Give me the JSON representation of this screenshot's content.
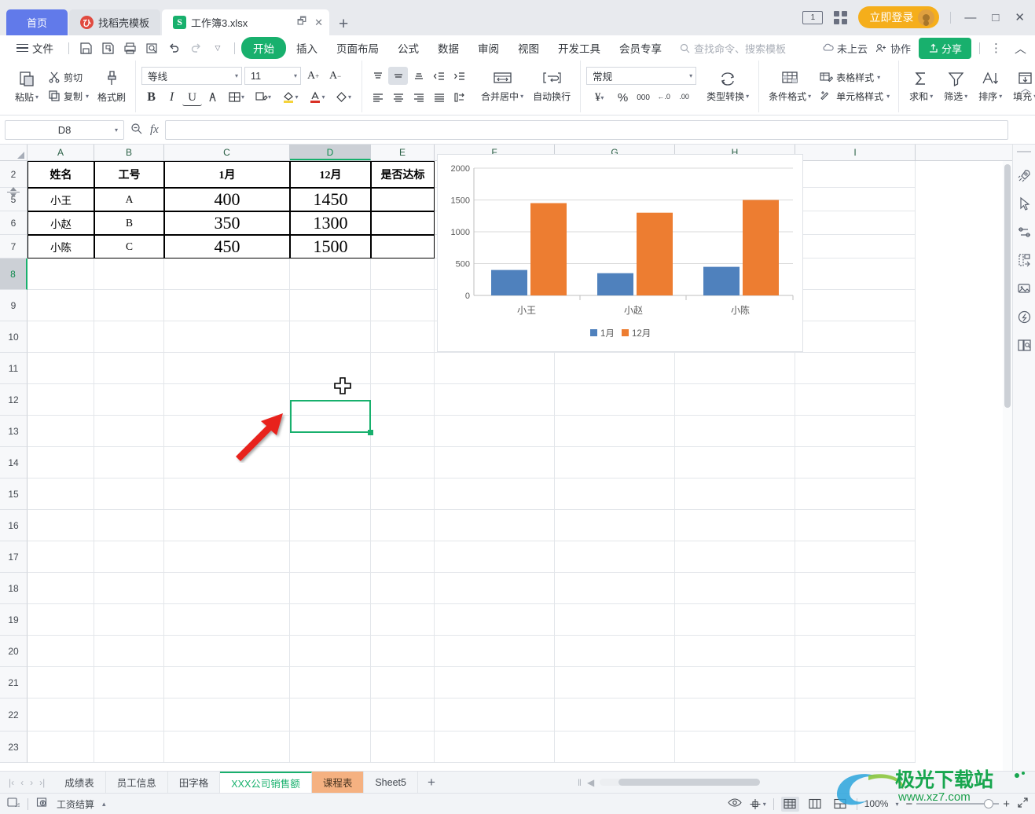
{
  "window": {
    "doc_tabs": [
      {
        "label": "首页",
        "icon": "home-icon"
      },
      {
        "label": "找稻壳模板",
        "icon": "docer-icon"
      },
      {
        "label": "工作簿3.xlsx",
        "icon": "spreadsheet-icon"
      }
    ],
    "new_tab": "+",
    "login_button": "立即登录",
    "minimize": "—",
    "maximize": "□",
    "close": "✕",
    "page_count_icon": "1",
    "layout_icon": "grid-icon"
  },
  "menu": {
    "file_label": "文件",
    "quick_access": [
      "save-icon",
      "save-as-icon",
      "print-icon",
      "print-preview-icon",
      "undo-icon",
      "redo-icon",
      "customize-icon"
    ],
    "tabs": [
      "开始",
      "插入",
      "页面布局",
      "公式",
      "数据",
      "审阅",
      "视图",
      "开发工具",
      "会员专享"
    ],
    "active_tab": "开始",
    "search_placeholder": "查找命令、搜索模板",
    "cloud_status": "未上云",
    "collaborate": "协作",
    "share": "分享",
    "more": "⋮",
    "collapse": "︿"
  },
  "ribbon": {
    "clipboard": {
      "paste": "粘贴",
      "cut": "剪切",
      "copy": "复制",
      "format_painter": "格式刷"
    },
    "font": {
      "family": "等线",
      "size": "11",
      "grow": "A+",
      "shrink": "A-",
      "bold": "B",
      "italic": "I",
      "underline": "U",
      "strike": "A",
      "borders": "borders-icon",
      "pinyin": "pinyin-icon",
      "fill": "fill-color-icon",
      "fontcolor": "font-color-icon",
      "clear": "clear-format-icon"
    },
    "alignment": {
      "top": "align-top-icon",
      "middle": "align-middle-icon",
      "bottom": "align-bottom-icon",
      "dec_indent": "decrease-indent-icon",
      "inc_indent": "increase-indent-icon",
      "left": "align-left-icon",
      "center": "align-center-icon",
      "right": "align-right-icon",
      "justify": "justify-icon",
      "orientation": "orientation-icon",
      "merge": "合并居中",
      "wrap": "自动换行"
    },
    "number": {
      "format": "常规",
      "currency": "¥",
      "percent": "%",
      "comma": "000",
      "dec_decimal": "←.0",
      "inc_decimal": ".00",
      "convert": "类型转换"
    },
    "styles": {
      "conditional": "条件格式",
      "table_style": "表格样式",
      "cell_style": "单元格样式"
    },
    "editing": {
      "sum": "求和",
      "filter": "筛选",
      "sort": "排序",
      "fill": "填充"
    }
  },
  "formula_bar": {
    "name_box": "D8",
    "fx_label": "fx",
    "zoom_icon": "zoom-out-icon",
    "value": ""
  },
  "sheet": {
    "columns": [
      "A",
      "B",
      "C",
      "D",
      "E",
      "F",
      "G",
      "H",
      "I"
    ],
    "selected_column": "D",
    "selected_row": "8",
    "visible_rows": [
      "2",
      "5",
      "6",
      "7",
      "8",
      "9",
      "10",
      "11",
      "12",
      "13",
      "14",
      "15",
      "16",
      "17",
      "18",
      "19",
      "20",
      "21",
      "22",
      "23"
    ],
    "table": {
      "headers": [
        "姓名",
        "工号",
        "1月",
        "12月",
        "是否达标"
      ],
      "rows": [
        {
          "row": "5",
          "cells": [
            "小王",
            "A",
            "400",
            "1450",
            ""
          ]
        },
        {
          "row": "6",
          "cells": [
            "小赵",
            "B",
            "350",
            "1300",
            ""
          ]
        },
        {
          "row": "7",
          "cells": [
            "小陈",
            "C",
            "450",
            "1500",
            ""
          ]
        }
      ]
    },
    "selected_cell": "D8"
  },
  "chart_data": {
    "type": "bar",
    "title": "",
    "categories": [
      "小王",
      "小赵",
      "小陈"
    ],
    "series": [
      {
        "name": "1月",
        "values": [
          400,
          350,
          450
        ],
        "color": "#4f81bd"
      },
      {
        "name": "12月",
        "values": [
          1450,
          1300,
          1500
        ],
        "color": "#ed7d31"
      }
    ],
    "ylim": [
      0,
      2000
    ],
    "yticks": [
      "0",
      "500",
      "1000",
      "1500",
      "2000"
    ],
    "xlabel": "",
    "ylabel": "",
    "grid": true,
    "legend_position": "bottom"
  },
  "sheet_tabs": {
    "nav": [
      "|‹",
      "‹",
      "›",
      "›|"
    ],
    "items": [
      "成绩表",
      "员工信息",
      "田字格",
      "XXX公司销售额",
      "课程表",
      "Sheet5"
    ],
    "active": "XXX公司销售额",
    "highlighted": "课程表",
    "add": "+"
  },
  "status_bar": {
    "left_items": [
      "js-icon",
      "工资结算"
    ],
    "payroll_label": "工资结算",
    "eye_icon": "eye-icon",
    "layout_icon": "cell-layout-icon",
    "views": [
      "normal-view-icon",
      "page-layout-icon",
      "page-break-icon"
    ],
    "zoom_level": "100%",
    "zoom_out": "−",
    "zoom_in": "+",
    "fullscreen": "fullscreen-icon"
  },
  "watermark": {
    "name": "极光下载站",
    "url": "www.xz7.com"
  },
  "right_sidebar": {
    "icons": [
      "rocket-icon",
      "cursor-icon",
      "sliders-icon",
      "table-arrange-icon",
      "image-icon",
      "lightbulb-icon",
      "book-icon"
    ]
  },
  "colors": {
    "accent_green": "#18b06d",
    "login_orange": "#f5ae1b",
    "series1": "#4f81bd",
    "series2": "#ed7d31",
    "home_blue": "#617aea"
  }
}
